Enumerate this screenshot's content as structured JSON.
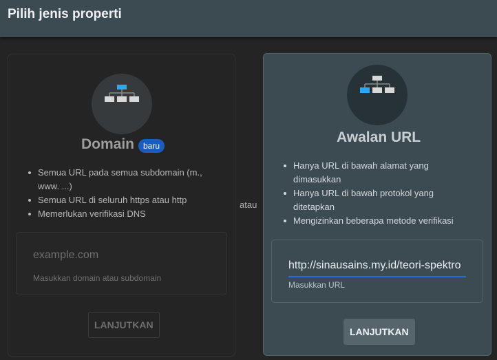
{
  "header": {
    "title": "Pilih jenis properti"
  },
  "separator": "atau",
  "domain_card": {
    "title": "Domain",
    "badge": "baru",
    "features": [
      "Semua URL pada semua subdomain (m., www. ...)",
      "Semua URL di seluruh https atau http",
      "Memerlukan verifikasi DNS"
    ],
    "input_placeholder": "example.com",
    "input_hint": "Masukkan domain atau subdomain",
    "button_label": "LANJUTKAN"
  },
  "url_card": {
    "title": "Awalan URL",
    "features": [
      "Hanya URL di bawah alamat yang dimasukkan",
      "Hanya URL di bawah protokol yang ditetapkan",
      "Mengizinkan beberapa metode verifikasi"
    ],
    "input_value": "http://sinausains.my.id/teori-spektro",
    "input_hint": "Masukkan URL",
    "button_label": "LANJUTKAN"
  },
  "colors": {
    "accent_blue": "#29a8ff",
    "badge_blue": "#1a5cbf",
    "selected_card": "#3c4a51"
  }
}
